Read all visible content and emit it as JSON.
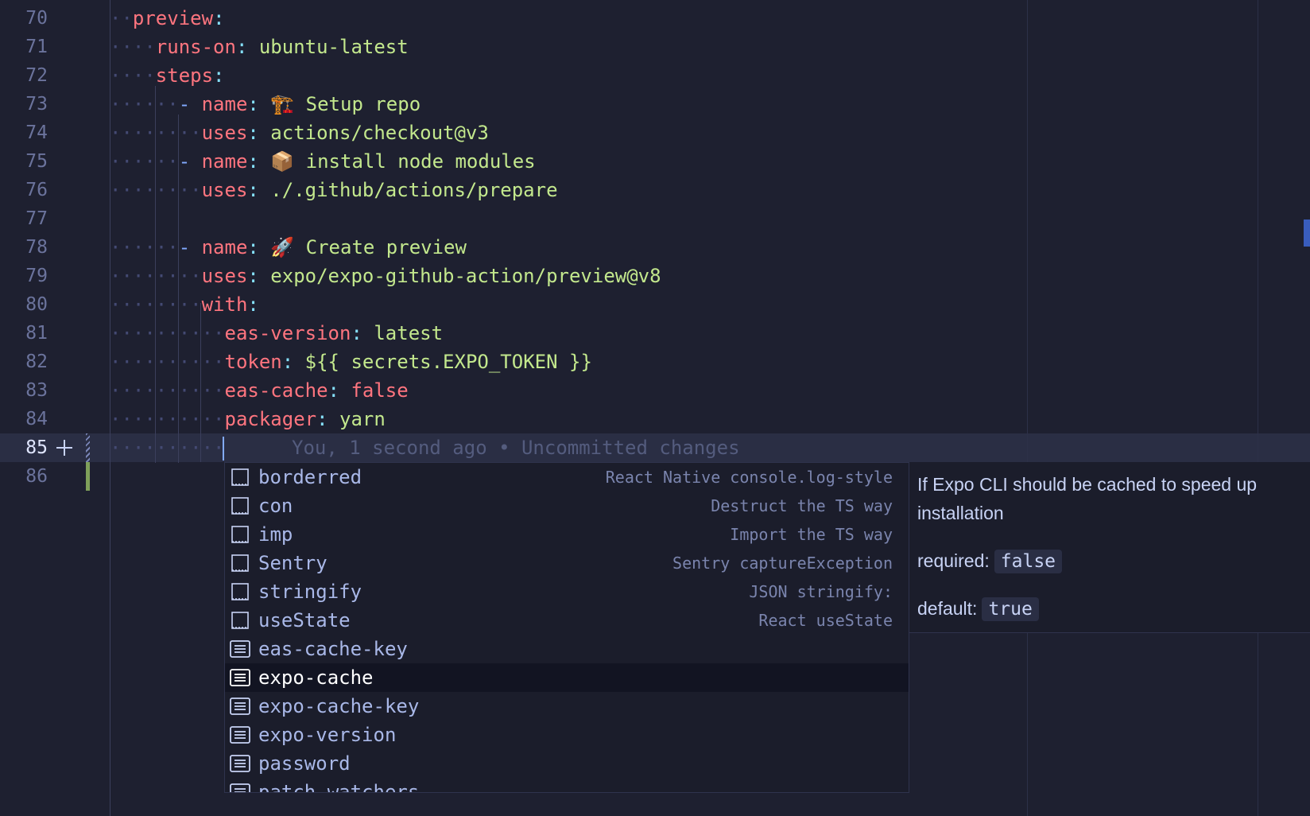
{
  "editor": {
    "line_numbers": [
      "70",
      "71",
      "72",
      "73",
      "74",
      "75",
      "76",
      "77",
      "78",
      "79",
      "80",
      "81",
      "82",
      "83",
      "84",
      "85",
      "86"
    ],
    "active_line": "85",
    "lines": {
      "l70": {
        "key": "preview"
      },
      "l71": {
        "key": "runs-on",
        "value": "ubuntu-latest"
      },
      "l72": {
        "key": "steps"
      },
      "l73": {
        "key": "name",
        "value": "🏗️ Setup repo"
      },
      "l74": {
        "key": "uses",
        "value": "actions/checkout@v3"
      },
      "l75": {
        "key": "name",
        "value": "📦 install node modules"
      },
      "l76": {
        "key": "uses",
        "value": "./.github/actions/prepare"
      },
      "l78": {
        "key": "name",
        "value": "🚀 Create preview"
      },
      "l79": {
        "key": "uses",
        "value": "expo/expo-github-action/preview@v8"
      },
      "l80": {
        "key": "with"
      },
      "l81": {
        "key": "eas-version",
        "value": "latest"
      },
      "l82": {
        "key": "token",
        "value": "${{ secrets.EXPO_TOKEN }}"
      },
      "l83": {
        "key": "eas-cache",
        "value": "false"
      },
      "l84": {
        "key": "packager",
        "value": "yarn"
      }
    },
    "blame_text": "You, 1 second ago • Uncommitted changes"
  },
  "suggest": {
    "items": [
      {
        "label": "borderred",
        "detail": "React Native console.log-style",
        "icon": "snippet-icon"
      },
      {
        "label": "con",
        "detail": "Destruct the TS way",
        "icon": "snippet-icon"
      },
      {
        "label": "imp",
        "detail": "Import the TS way",
        "icon": "snippet-icon"
      },
      {
        "label": "Sentry",
        "detail": "Sentry captureException",
        "icon": "snippet-icon"
      },
      {
        "label": "stringify",
        "detail": "JSON stringify:",
        "icon": "snippet-icon"
      },
      {
        "label": "useState",
        "detail": "React useState",
        "icon": "snippet-icon"
      },
      {
        "label": "eas-cache-key",
        "detail": "",
        "icon": "property-icon"
      },
      {
        "label": "expo-cache",
        "detail": "",
        "icon": "property-icon",
        "selected": true
      },
      {
        "label": "expo-cache-key",
        "detail": "",
        "icon": "property-icon"
      },
      {
        "label": "expo-version",
        "detail": "",
        "icon": "property-icon"
      },
      {
        "label": "password",
        "detail": "",
        "icon": "property-icon"
      },
      {
        "label": "patch-watchers",
        "detail": "",
        "icon": "property-icon"
      }
    ]
  },
  "docs": {
    "description": "If Expo CLI should be cached to speed up installation",
    "required_label": "required:",
    "required_value": "false",
    "default_label": "default:",
    "default_value": "true"
  }
}
